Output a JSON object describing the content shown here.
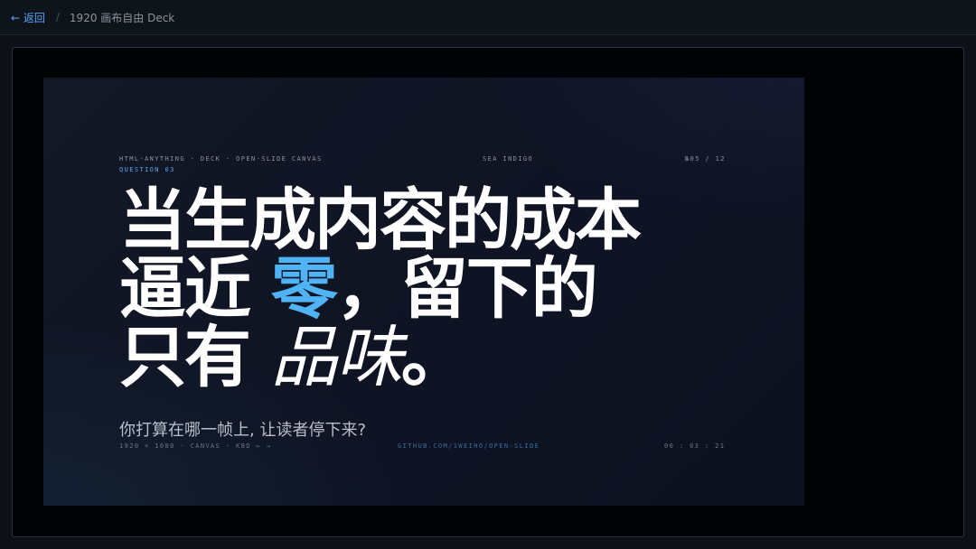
{
  "topbar": {
    "back_label": "← 返回",
    "separator": "/",
    "title": "1920 画布自由 Deck"
  },
  "slide": {
    "meta_left": "HTML-ANYTHING · DECK · OPEN-SLIDE CANVAS",
    "meta_center": "SEA INDIGO",
    "meta_right": "№05 / 12",
    "question_label": "QUESTION 03",
    "headline": {
      "line1": "当生成内容的成本",
      "line2_pre": "逼近 ",
      "line2_hl": "零",
      "line2_post": "，留下的",
      "line3_pre": "只有 ",
      "line3_it": "品味",
      "line3_end": "。"
    },
    "question_text": "你打算在哪一帧上, 让读者停下来?",
    "footer_left": "1920 × 1080 · CANVAS · KBD ← →",
    "footer_center": "GITHUB.COM/1WEIHO/OPEN-SLIDE",
    "footer_right": "00 : 03 : 21"
  },
  "colors": {
    "accent": "#4fb3f6",
    "link": "#58a6ff"
  }
}
